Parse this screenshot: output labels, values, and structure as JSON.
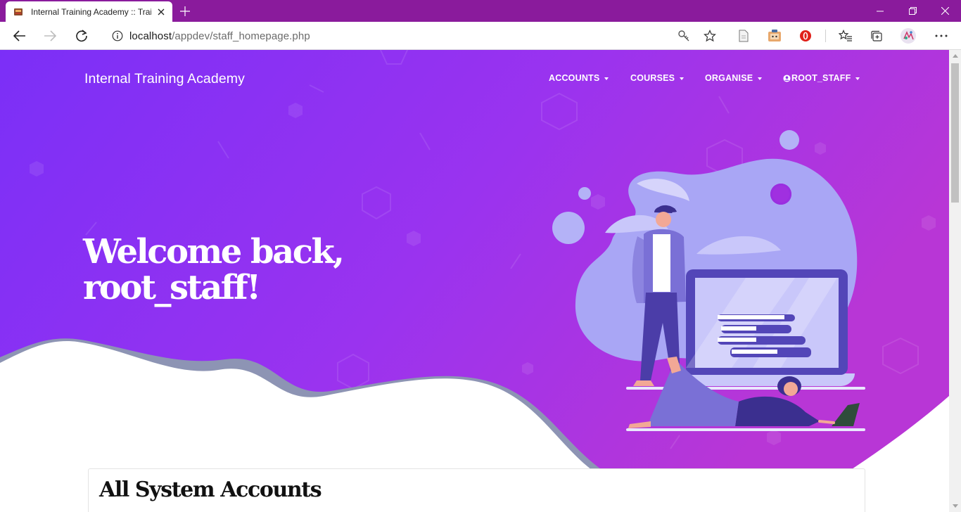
{
  "browser": {
    "tab_title": "Internal Training Academy :: Training",
    "url_host": "localhost",
    "url_path": "/appdev/staff_homepage.php"
  },
  "navbar": {
    "brand": "Internal Training Academy",
    "menu": [
      {
        "label": "ACCOUNTS"
      },
      {
        "label": "COURSES"
      },
      {
        "label": "ORGANISE"
      },
      {
        "label": "ROOT_STAFF"
      }
    ]
  },
  "hero": {
    "heading_line1": "Welcome back,",
    "heading_line2": "root_staff!"
  },
  "section": {
    "title": "All System Accounts"
  },
  "colors": {
    "titlebar": "#8a1b9c",
    "hero_gradient_start": "#7b2ff7",
    "hero_gradient_end": "#b836d6",
    "wave_shadow": "#8d94b4",
    "illustration_primary": "#5b4dc7",
    "illustration_light": "#a9a6f5"
  },
  "icons": [
    "favicon-icon",
    "close-icon",
    "plus-icon",
    "back-icon",
    "forward-icon",
    "refresh-icon",
    "info-icon",
    "key-icon",
    "star-icon",
    "reading-icon",
    "extension-icon",
    "opera-icon",
    "favorites-icon",
    "collections-icon",
    "profile-icon",
    "more-icon",
    "user-circle-icon",
    "caret-down-icon"
  ]
}
